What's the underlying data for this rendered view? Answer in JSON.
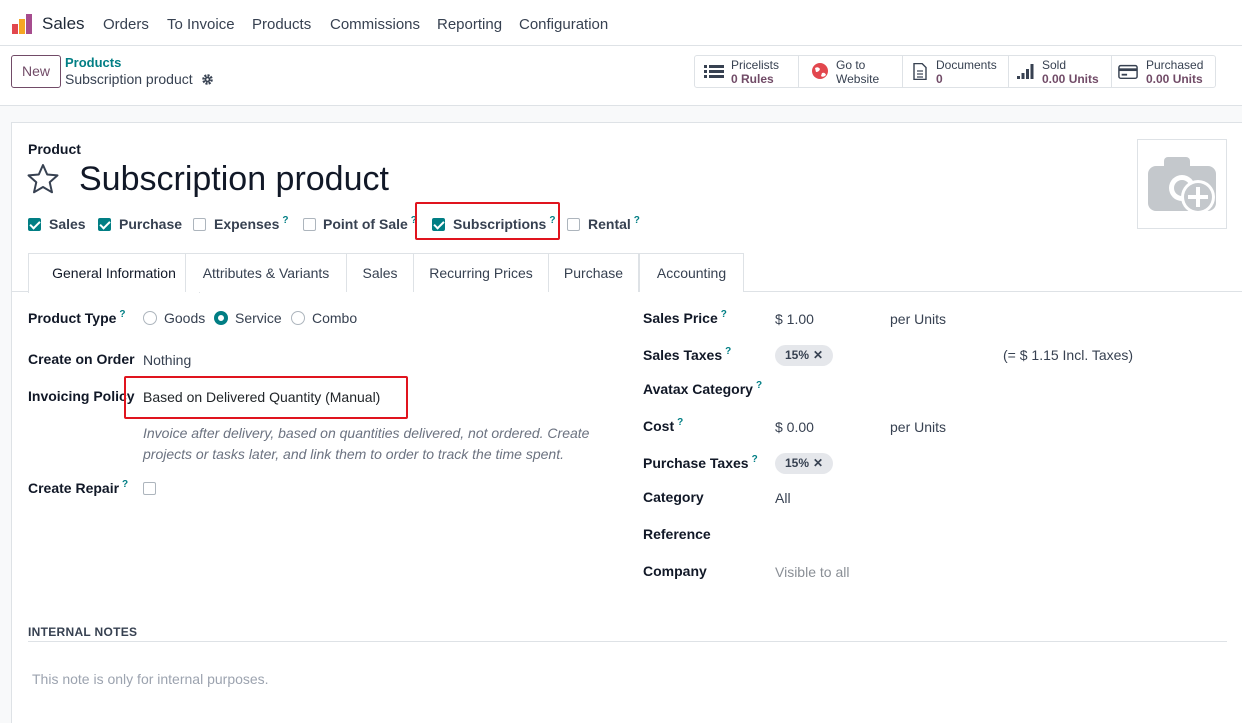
{
  "navbar": {
    "app_name": "Sales",
    "menu": [
      "Orders",
      "To Invoice",
      "Products",
      "Commissions",
      "Reporting",
      "Configuration"
    ]
  },
  "control": {
    "new_label": "New",
    "breadcrumb_parent": "Products",
    "breadcrumb_current": "Subscription product",
    "smart_buttons": [
      {
        "title": "Pricelists",
        "value": "0 Rules",
        "icon": "list-icon"
      },
      {
        "title": "Go to",
        "value": "Website",
        "icon": "globe-icon"
      },
      {
        "title": "Documents",
        "value": "0",
        "icon": "document-icon"
      },
      {
        "title": "Sold",
        "value": "0.00 Units",
        "icon": "signal-bars-icon"
      },
      {
        "title": "Purchased",
        "value": "0.00 Units",
        "icon": "credit-card-icon"
      }
    ]
  },
  "form": {
    "product_label": "Product",
    "title": "Subscription product",
    "checkboxes": [
      {
        "label": "Sales",
        "checked": true,
        "help": false
      },
      {
        "label": "Purchase",
        "checked": true,
        "help": false
      },
      {
        "label": "Expenses",
        "checked": false,
        "help": true
      },
      {
        "label": "Point of Sale",
        "checked": false,
        "help": true
      },
      {
        "label": "Subscriptions",
        "checked": true,
        "help": true
      },
      {
        "label": "Rental",
        "checked": false,
        "help": true
      }
    ],
    "help_mark": "?",
    "tabs": [
      "General Information",
      "Attributes & Variants",
      "Sales",
      "Recurring Prices",
      "Purchase",
      "Accounting"
    ],
    "left": {
      "product_type_label": "Product Type",
      "product_type_options": [
        "Goods",
        "Service",
        "Combo"
      ],
      "product_type_selected": "Service",
      "create_on_order_label": "Create on Order",
      "create_on_order_value": "Nothing",
      "invoicing_policy_label": "Invoicing Policy",
      "invoicing_policy_value": "Based on Delivered Quantity (Manual)",
      "invoicing_hint": "Invoice after delivery, based on quantities delivered, not ordered. Create projects or tasks later, and link them to order to track the time spent.",
      "create_repair_label": "Create Repair"
    },
    "right": {
      "sales_price_label": "Sales Price",
      "sales_price_value": "$ 1.00",
      "sales_price_unit": "per Units",
      "sales_taxes_label": "Sales Taxes",
      "sales_taxes_badge": "15%",
      "sales_taxes_incl": "(= $ 1.15 Incl. Taxes)",
      "avatax_label": "Avatax Category",
      "cost_label": "Cost",
      "cost_value": "$ 0.00",
      "cost_unit": "per Units",
      "purchase_taxes_label": "Purchase Taxes",
      "purchase_taxes_badge": "15%",
      "category_label": "Category",
      "category_value": "All",
      "reference_label": "Reference",
      "company_label": "Company",
      "company_placeholder": "Visible to all"
    },
    "notes_header": "INTERNAL NOTES",
    "notes_placeholder": "This note is only for internal purposes.",
    "close_mark": "✕"
  },
  "colors": {
    "brand": "#714b67",
    "accent": "#017e84",
    "highlight": "#e0141e"
  }
}
